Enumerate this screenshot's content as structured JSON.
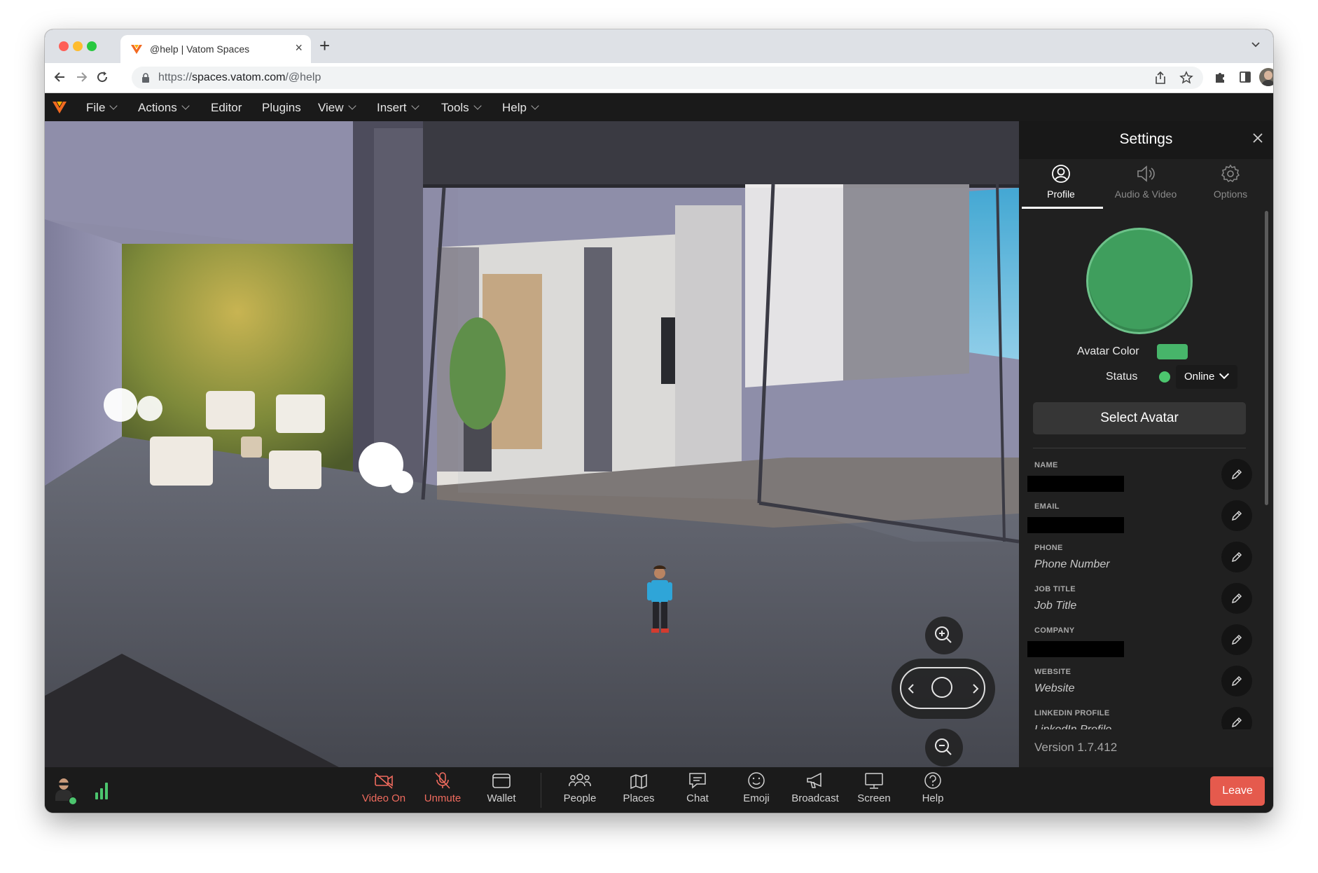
{
  "browser": {
    "tab_title": "@help | Vatom Spaces",
    "url_prefix": "https://",
    "url_host": "spaces.vatom.com",
    "url_path": "/@help"
  },
  "menu": {
    "items": [
      "File",
      "Actions",
      "Editor",
      "Plugins",
      "View",
      "Insert",
      "Tools",
      "Help"
    ]
  },
  "settings": {
    "title": "Settings",
    "tabs": [
      {
        "label": "Profile",
        "icon": "user-circle-icon"
      },
      {
        "label": "Audio & Video",
        "icon": "speaker-icon"
      },
      {
        "label": "Options",
        "icon": "gear-icon"
      }
    ],
    "avatar_color_label": "Avatar Color",
    "avatar_color": "#47b56a",
    "status_label": "Status",
    "status_value": "Online",
    "status_color": "#4cc56e",
    "select_avatar_label": "Select Avatar",
    "fields": [
      {
        "label": "NAME",
        "value": ""
      },
      {
        "label": "EMAIL",
        "value": ""
      },
      {
        "label": "PHONE",
        "value": "Phone Number"
      },
      {
        "label": "JOB TITLE",
        "value": "Job Title"
      },
      {
        "label": "COMPANY",
        "value": ""
      },
      {
        "label": "WEBSITE",
        "value": "Website"
      },
      {
        "label": "LINKEDIN PROFILE",
        "value": "LinkedIn Profile"
      }
    ],
    "version": "Version 1.7.412"
  },
  "toolbar": {
    "video": "Video On",
    "mic": "Unmute",
    "wallet": "Wallet",
    "people": "People",
    "places": "Places",
    "chat": "Chat",
    "emoji": "Emoji",
    "broadcast": "Broadcast",
    "screen": "Screen",
    "help": "Help",
    "leave": "Leave"
  },
  "colors": {
    "accent_red": "#e55a4d",
    "muted_red": "#ef6b5e",
    "panel_bg": "#202020"
  }
}
